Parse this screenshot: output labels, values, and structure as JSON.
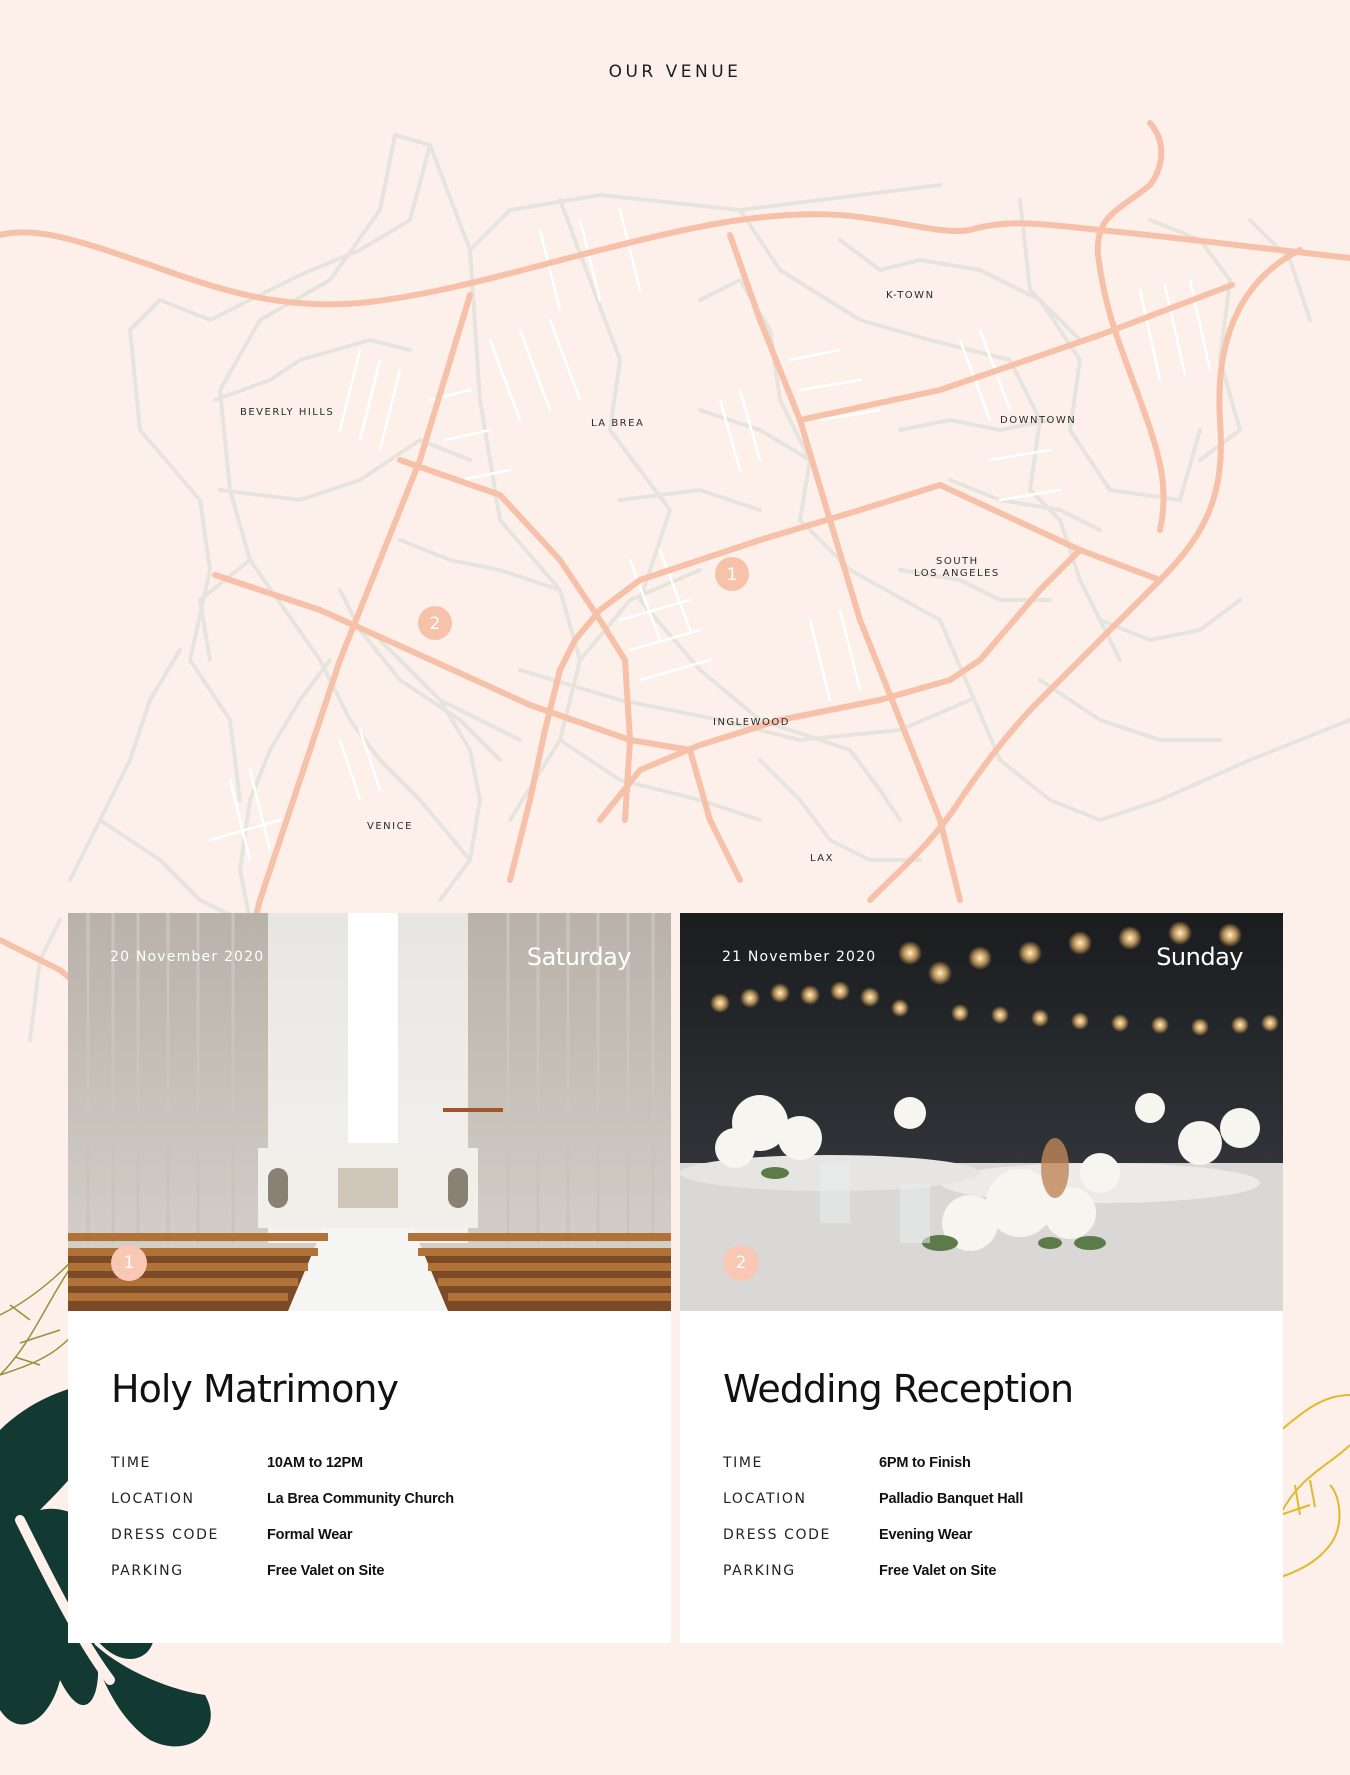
{
  "section": {
    "title": "OUR VENUE"
  },
  "map": {
    "labels": {
      "beverly_hills": "BEVERLY HILLS",
      "la_brea": "LA BREA",
      "k_town": "K-TOWN",
      "downtown": "DOWNTOWN",
      "south_la_1": "SOUTH",
      "south_la_2": "LOS ANGELES",
      "inglewood": "INGLEWOOD",
      "venice": "VENICE",
      "lax": "LAX"
    },
    "pins": {
      "pin1": "1",
      "pin2": "2"
    },
    "colors": {
      "major_road": "#f6c1a8",
      "minor_road": "#e6e5dd",
      "background": "#fdf0ea"
    }
  },
  "events": [
    {
      "date": "20 November 2020",
      "day": "Saturday",
      "badge": "1",
      "title": "Holy Matrimony",
      "details": [
        {
          "label": "TIME",
          "value": "10AM to 12PM"
        },
        {
          "label": "LOCATION",
          "value": "La Brea Community Church"
        },
        {
          "label": "DRESS CODE",
          "value": "Formal Wear"
        },
        {
          "label": "PARKING",
          "value": "Free Valet on Site"
        }
      ]
    },
    {
      "date": "21 November 2020",
      "day": "Sunday",
      "badge": "2",
      "title": "Wedding Reception",
      "details": [
        {
          "label": "TIME",
          "value": "6PM to Finish"
        },
        {
          "label": "LOCATION",
          "value": "Palladio Banquet Hall"
        },
        {
          "label": "DRESS CODE",
          "value": "Evening Wear"
        },
        {
          "label": "PARKING",
          "value": "Free Valet on Site"
        }
      ]
    }
  ],
  "decor": {
    "icons": [
      "monstera-leaf-icon",
      "olive-outline-leaf-icon",
      "gold-branch-icon"
    ],
    "colors": {
      "leaf_dark": "#123a32",
      "leaf_olive": "#9a8e3a",
      "leaf_gold": "#e2b92a"
    }
  }
}
